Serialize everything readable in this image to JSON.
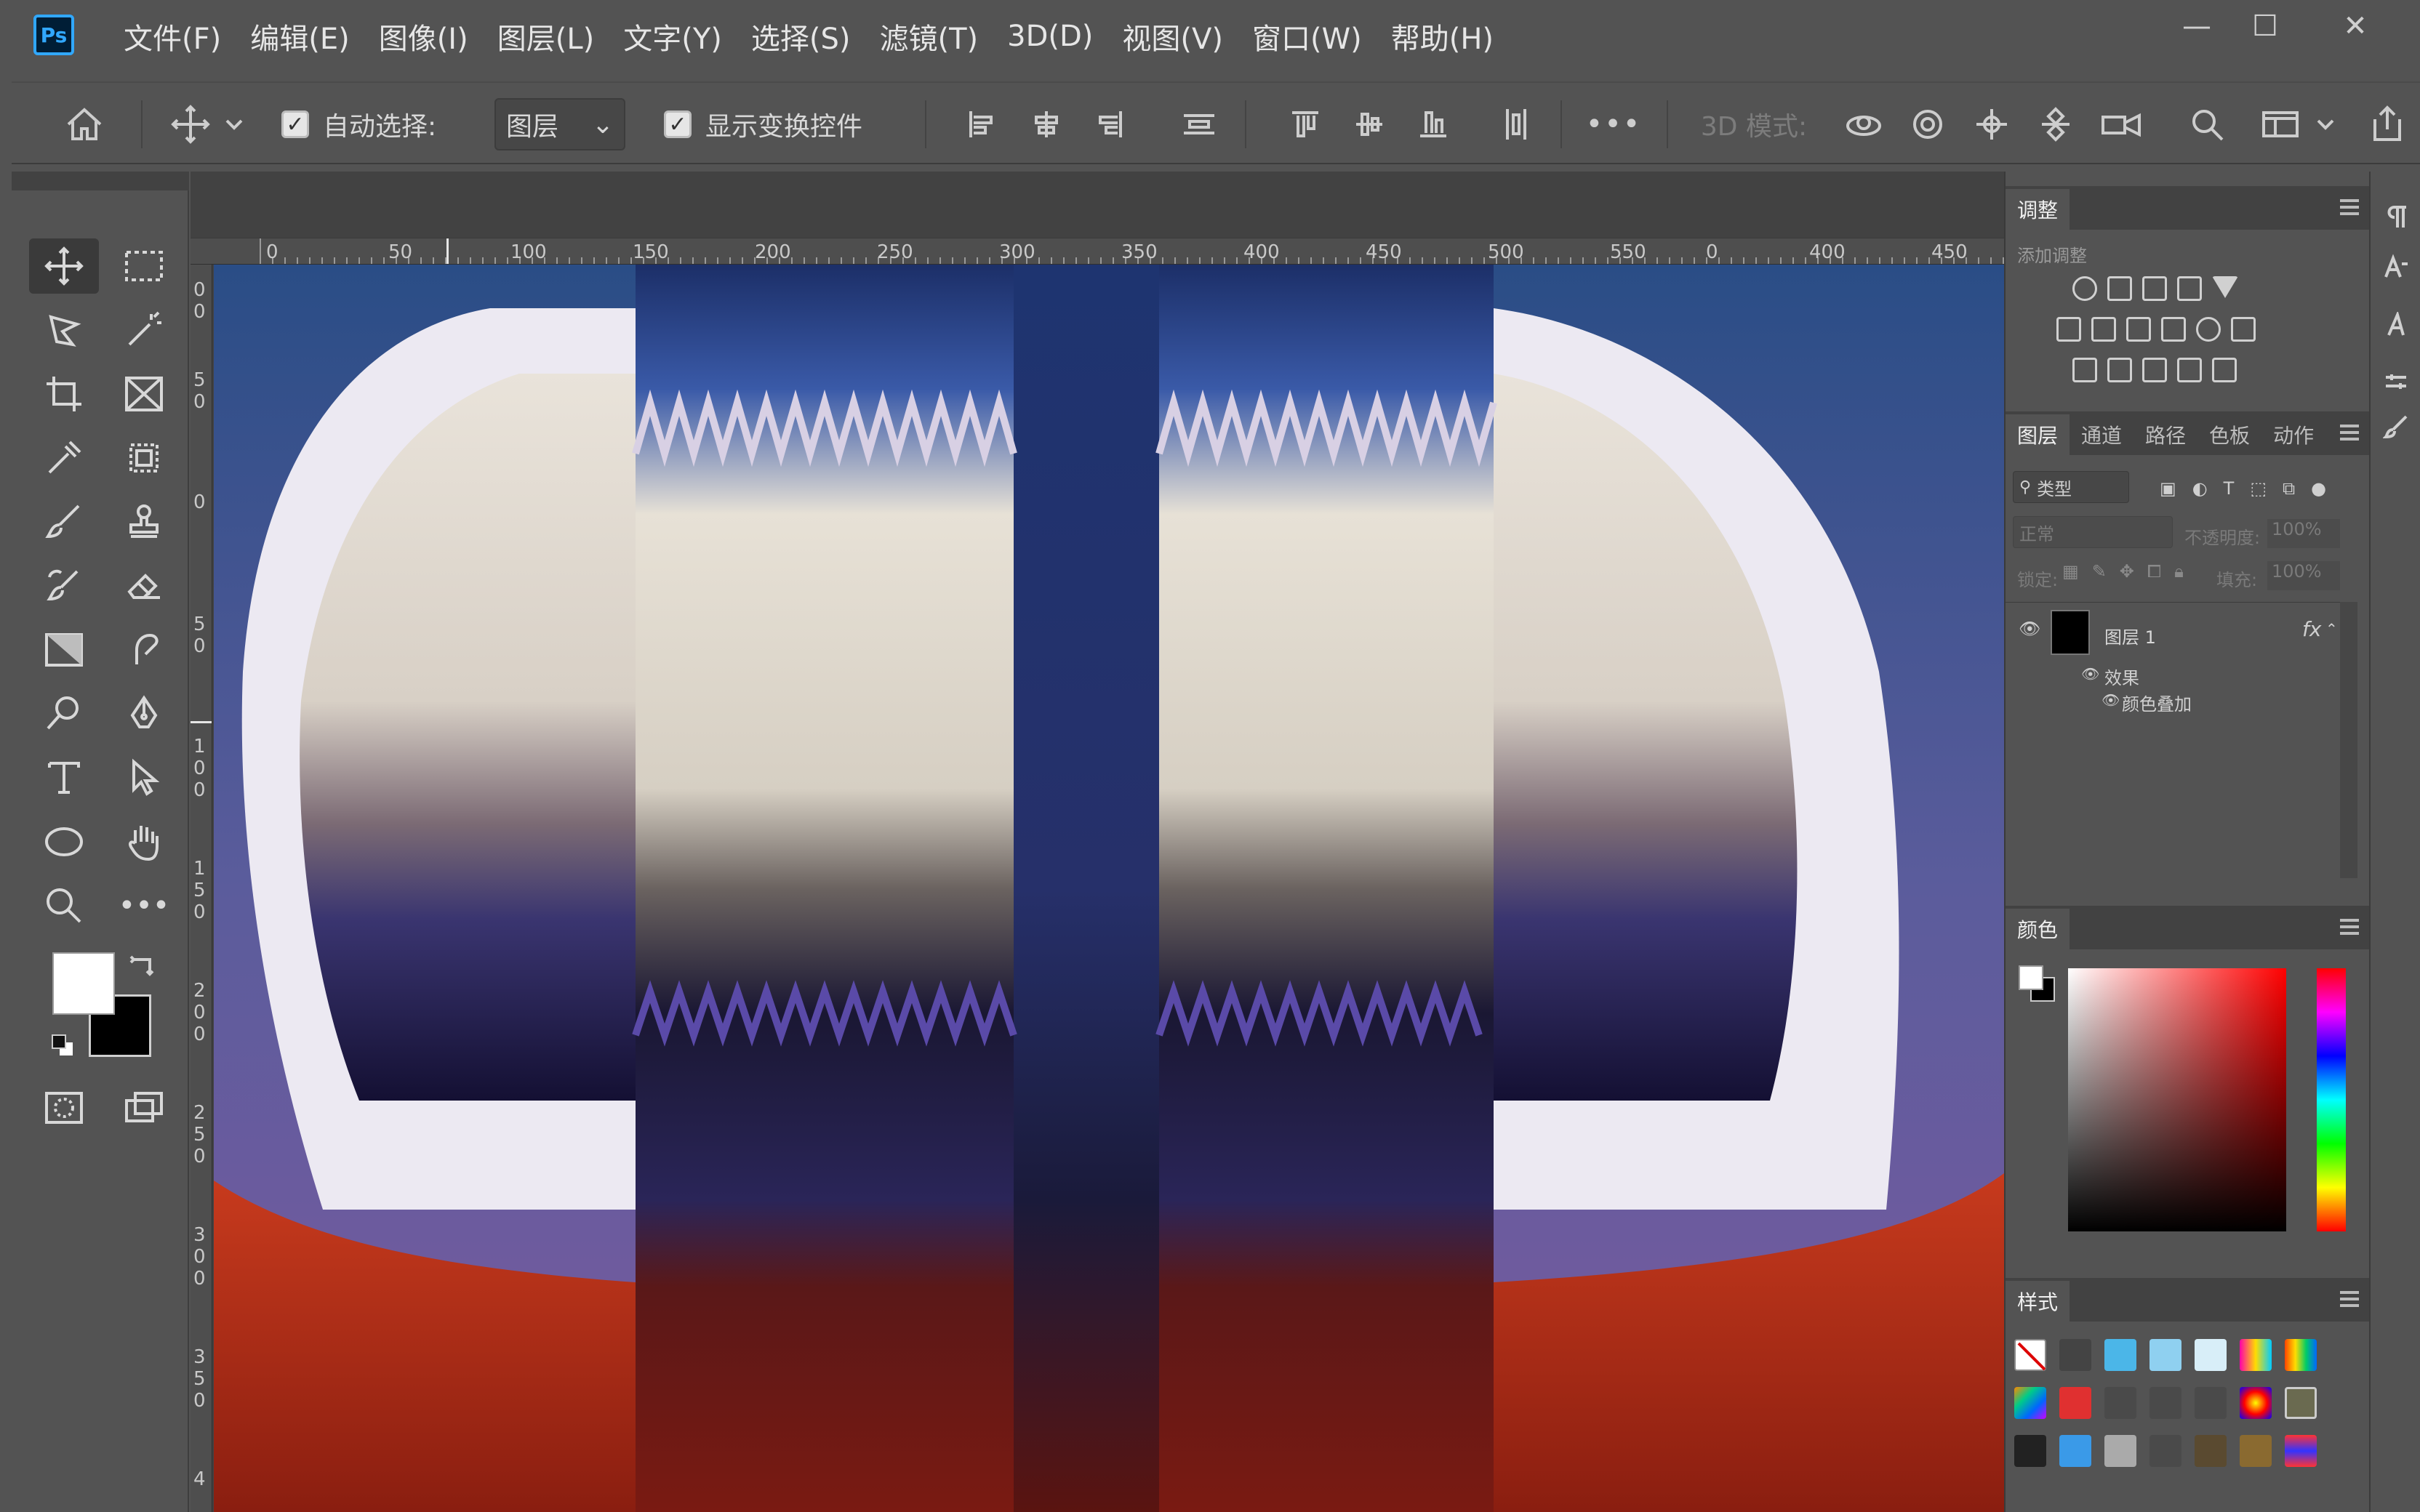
{
  "app": {
    "name": "Photoshop",
    "logo": "Ps"
  },
  "menu": [
    "文件(F)",
    "编辑(E)",
    "图像(I)",
    "图层(L)",
    "文字(Y)",
    "选择(S)",
    "滤镜(T)",
    "3D(D)",
    "视图(V)",
    "窗口(W)",
    "帮助(H)"
  ],
  "window_controls": {
    "minimize": "—",
    "maximize": "☐",
    "close": "✕"
  },
  "options": {
    "auto_select_label": "自动选择:",
    "auto_select_value": "图层",
    "show_transform_label": "显示变换控件",
    "more_label": "•••",
    "mode_3d_label": "3D 模式:"
  },
  "tools": {
    "more_tools": "•••"
  },
  "ruler": {
    "h_ticks": [
      "0",
      "50",
      "100",
      "150",
      "200",
      "250",
      "300",
      "350",
      "400",
      "450",
      "500",
      "550",
      "0",
      "400",
      "450"
    ],
    "v_ticks": [
      "0",
      "0",
      "5",
      "0",
      "0",
      "5",
      "0",
      "1",
      "0",
      "0",
      "1",
      "5",
      "0",
      "2",
      "0",
      "0",
      "2",
      "5",
      "0",
      "3",
      "0",
      "0",
      "3",
      "5",
      "0",
      "4"
    ]
  },
  "adjustments": {
    "tab": "调整",
    "add_label": "添加调整"
  },
  "layers": {
    "tabs": [
      "图层",
      "通道",
      "路径",
      "色板",
      "动作"
    ],
    "filter_type": "类型",
    "blend_mode": "正常",
    "opacity_label": "不透明度:",
    "opacity_value": "100%",
    "lock_label": "锁定:",
    "fill_label": "填充:",
    "fill_value": "100%",
    "layer_name": "图层 1",
    "fx_label": "fx",
    "effects_label": "效果",
    "effect_item": "颜色叠加"
  },
  "color": {
    "tab": "颜色",
    "hue_color": "#ff0000"
  },
  "styles": {
    "tab": "样式"
  },
  "colors": {
    "foreground": "#ffffff",
    "background": "#000000",
    "accent": "#31a8ff"
  }
}
